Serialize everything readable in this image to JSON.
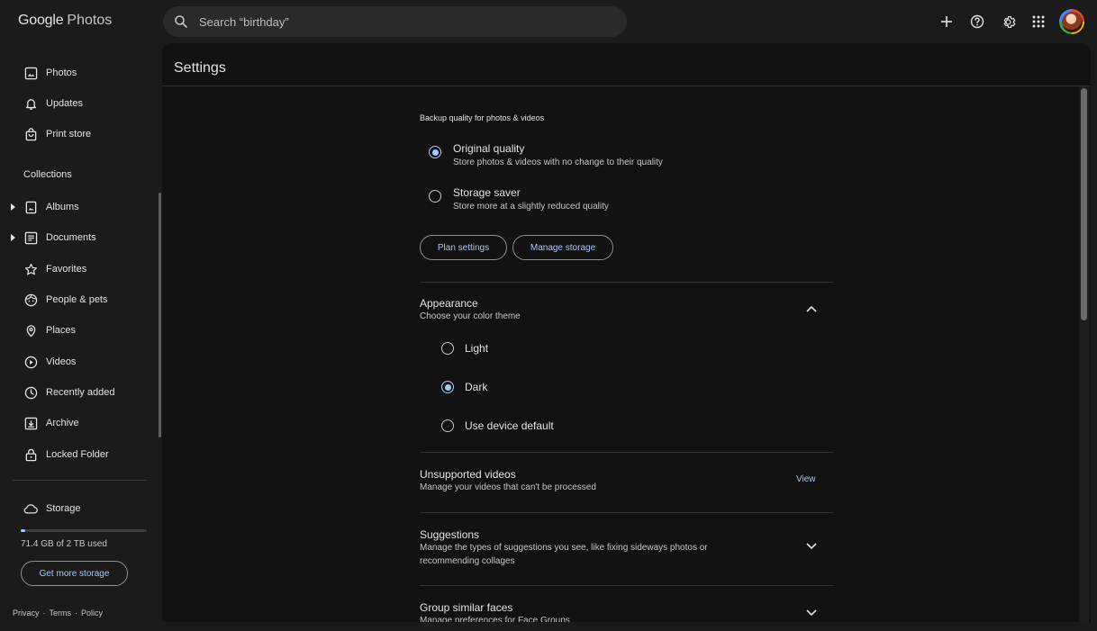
{
  "app": {
    "logo_google": "Google",
    "logo_photos": "Photos",
    "search_placeholder": "Search “birthday”"
  },
  "sidebar": {
    "items": [
      {
        "label": "Photos"
      },
      {
        "label": "Updates"
      },
      {
        "label": "Print store"
      }
    ],
    "collections_heading": "Collections",
    "collections": [
      {
        "label": "Albums"
      },
      {
        "label": "Documents"
      },
      {
        "label": "Favorites"
      },
      {
        "label": "People & pets"
      },
      {
        "label": "Places"
      },
      {
        "label": "Videos"
      },
      {
        "label": "Recently added"
      },
      {
        "label": "Archive"
      },
      {
        "label": "Locked Folder"
      }
    ],
    "storage": {
      "label": "Storage",
      "used_text": "71.4 GB of 2 TB used",
      "used_fraction": 0.036,
      "button": "Get more storage"
    },
    "footer": {
      "privacy": "Privacy",
      "sep1": "·",
      "terms": "Terms",
      "sep2": "·",
      "policy": "Policy"
    }
  },
  "settings": {
    "title": "Settings",
    "backup": {
      "heading": "Backup quality for photos & videos",
      "options": [
        {
          "title": "Original quality",
          "subtitle": "Store photos & videos with no change to their quality",
          "selected": true
        },
        {
          "title": "Storage saver",
          "subtitle": "Store more at a slightly reduced quality",
          "selected": false
        }
      ],
      "plan_button": "Plan settings",
      "manage_button": "Manage storage"
    },
    "appearance": {
      "title": "Appearance",
      "subtitle": "Choose your color theme",
      "options": [
        {
          "label": "Light",
          "selected": false
        },
        {
          "label": "Dark",
          "selected": true
        },
        {
          "label": "Use device default",
          "selected": false
        }
      ]
    },
    "unsupported": {
      "title": "Unsupported videos",
      "subtitle": "Manage your videos that can't be processed",
      "action": "View"
    },
    "suggestions": {
      "title": "Suggestions",
      "subtitle_line1": "Manage the types of suggestions you see, like fixing sideways photos or",
      "subtitle_line2": "recommending collages"
    },
    "faces": {
      "title": "Group similar faces",
      "subtitle": "Manage preferences for Face Groups"
    }
  },
  "colors": {
    "accent": "#a8c7fa",
    "background": "#1b1b1b",
    "panel": "#121212"
  }
}
